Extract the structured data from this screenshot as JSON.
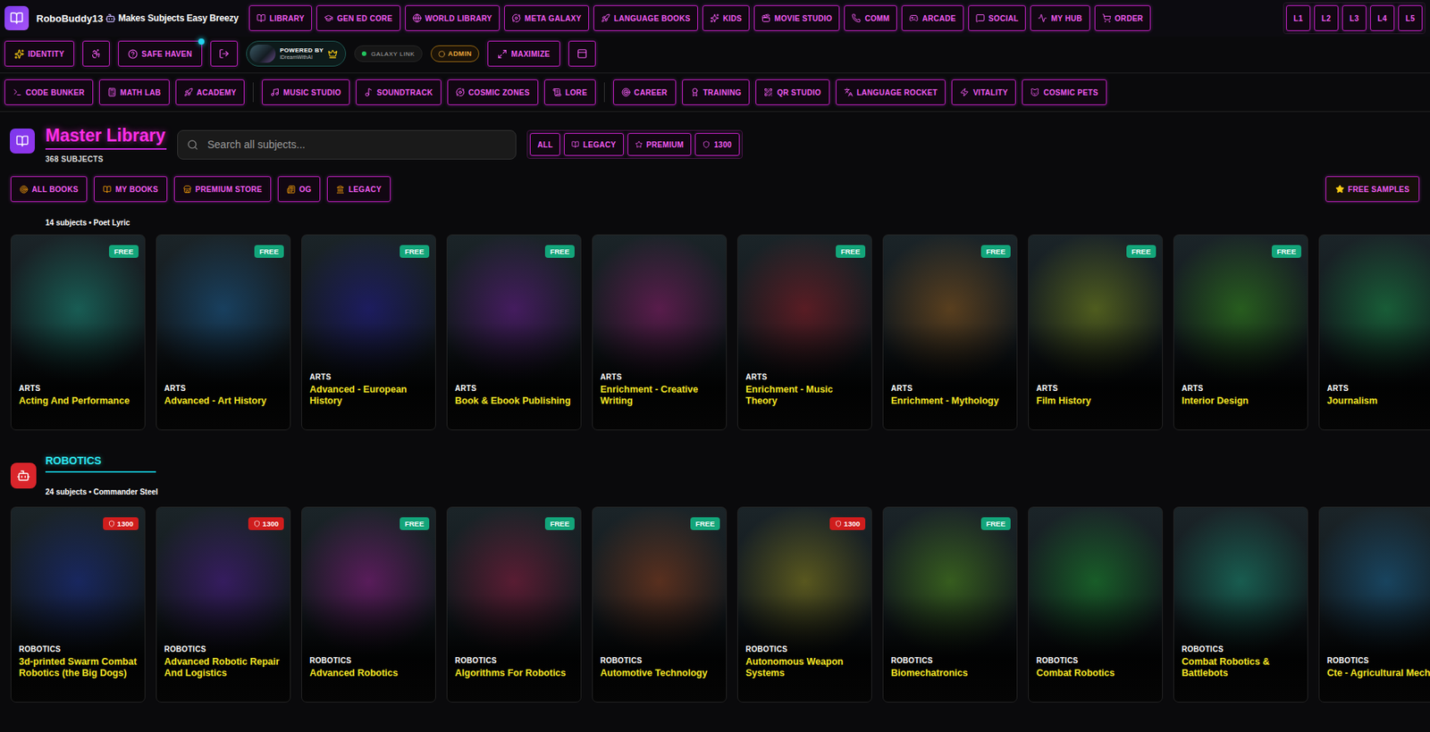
{
  "app": {
    "title": "RoboBuddy13",
    "tagline": "Makes Subjects Easy Breezy"
  },
  "main_nav": [
    "LIBRARY",
    "GEN ED CORE",
    "WORLD LIBRARY",
    "META GALAXY",
    "LANGUAGE BOOKS",
    "KIDS",
    "MOVIE STUDIO",
    "COMM",
    "ARCADE",
    "SOCIAL",
    "MY HUB",
    "ORDER"
  ],
  "levels": [
    "L1",
    "L2",
    "L3",
    "L4",
    "L5"
  ],
  "toolbar": [
    {
      "kind": "button",
      "label": "IDENTITY"
    },
    {
      "kind": "icon"
    },
    {
      "kind": "button",
      "label": "SAFE HAVEN",
      "notification": true
    },
    {
      "kind": "icon"
    },
    {
      "kind": "powered",
      "line1": "POWERED BY",
      "line2": "iDreamWithAI"
    },
    {
      "kind": "status",
      "label": "GALAXY LINK",
      "online": true
    },
    {
      "kind": "admin",
      "label": "ADMIN"
    },
    {
      "kind": "button",
      "label": "MAXIMIZE"
    },
    {
      "kind": "icon"
    }
  ],
  "tool_groups": [
    [
      "CODE BUNKER",
      "MATH LAB",
      "ACADEMY"
    ],
    [
      "MUSIC STUDIO",
      "SOUNDTRACK",
      "COSMIC ZONES",
      "LORE"
    ],
    [
      "CAREER",
      "TRAINING",
      "QR STUDIO",
      "LANGUAGE ROCKET",
      "VITALITY",
      "COSMIC PETS"
    ]
  ],
  "library": {
    "title": "Master Library",
    "count": "368 SUBJECTS"
  },
  "search": {
    "placeholder": "Search all subjects..."
  },
  "filters": [
    "ALL",
    "LEGACY",
    "PREMIUM",
    "1300"
  ],
  "shelves": [
    "ALL BOOKS",
    "MY BOOKS",
    "PREMIUM STORE",
    "OG",
    "LEGACY"
  ],
  "free_samples": "FREE SAMPLES",
  "sections": [
    {
      "title": null,
      "subtitle": "14 subjects • Poet Lyric",
      "cards": [
        {
          "category": "ARTS",
          "title": "Acting And Performance",
          "badge": {
            "kind": "free",
            "text": "FREE"
          }
        },
        {
          "category": "ARTS",
          "title": "Advanced - Art History",
          "badge": {
            "kind": "free",
            "text": "FREE"
          }
        },
        {
          "category": "ARTS",
          "title": "Advanced - European History",
          "badge": {
            "kind": "free",
            "text": "FREE"
          }
        },
        {
          "category": "ARTS",
          "title": "Book & Ebook Publishing",
          "badge": {
            "kind": "free",
            "text": "FREE"
          }
        },
        {
          "category": "ARTS",
          "title": "Enrichment - Creative Writing",
          "badge": null
        },
        {
          "category": "ARTS",
          "title": "Enrichment - Music Theory",
          "badge": {
            "kind": "free",
            "text": "FREE"
          }
        },
        {
          "category": "ARTS",
          "title": "Enrichment - Mythology",
          "badge": {
            "kind": "free",
            "text": "FREE"
          }
        },
        {
          "category": "ARTS",
          "title": "Film History",
          "badge": {
            "kind": "free",
            "text": "FREE"
          }
        },
        {
          "category": "ARTS",
          "title": "Interior Design",
          "badge": {
            "kind": "free",
            "text": "FREE"
          }
        },
        {
          "category": "ARTS",
          "title": "Journalism",
          "badge": null
        }
      ]
    },
    {
      "title": "ROBOTICS",
      "subtitle": "24 subjects • Commander Steel",
      "cards": [
        {
          "category": "ROBOTICS",
          "title": "3d-printed Swarm Combat Robotics (the Big Dogs)",
          "badge": {
            "kind": "premium",
            "text": "1300"
          }
        },
        {
          "category": "ROBOTICS",
          "title": "Advanced Robotic Repair And Logistics",
          "badge": {
            "kind": "premium",
            "text": "1300"
          }
        },
        {
          "category": "ROBOTICS",
          "title": "Advanced Robotics",
          "badge": {
            "kind": "free",
            "text": "FREE"
          }
        },
        {
          "category": "ROBOTICS",
          "title": "Algorithms For Robotics",
          "badge": {
            "kind": "free",
            "text": "FREE"
          }
        },
        {
          "category": "ROBOTICS",
          "title": "Automotive Technology",
          "badge": {
            "kind": "free",
            "text": "FREE"
          }
        },
        {
          "category": "ROBOTICS",
          "title": "Autonomous Weapon Systems",
          "badge": {
            "kind": "premium",
            "text": "1300"
          }
        },
        {
          "category": "ROBOTICS",
          "title": "Biomechatronics",
          "badge": {
            "kind": "free",
            "text": "FREE"
          }
        },
        {
          "category": "ROBOTICS",
          "title": "Combat Robotics",
          "badge": null
        },
        {
          "category": "ROBOTICS",
          "title": "Combat Robotics & Battlebots",
          "badge": null
        },
        {
          "category": "ROBOTICS",
          "title": "Cte - Agricultural Mech",
          "badge": null
        }
      ]
    }
  ]
}
